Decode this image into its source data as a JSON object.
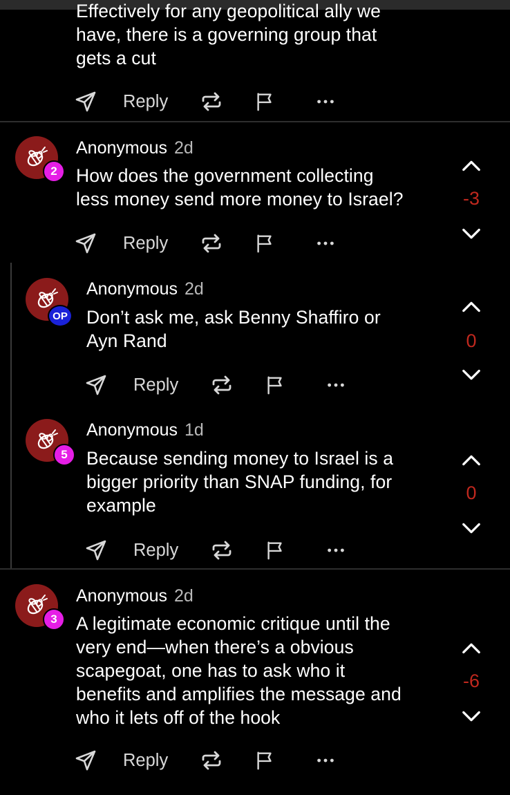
{
  "partial_comment": {
    "lines": [
      "Effectively for any geopolitical ally we",
      "have, there is a governing group that",
      "gets a cut"
    ],
    "reply_label": "Reply"
  },
  "comments": [
    {
      "author": "Anonymous",
      "time": "2d",
      "badge": "2",
      "lines": [
        "How does the government collecting",
        "less money send more money to Israel?"
      ],
      "score": "-3",
      "reply_label": "Reply"
    },
    {
      "author": "Anonymous",
      "time": "2d",
      "badge": "OP",
      "lines": [
        "Don’t ask me, ask Benny Shaffiro or",
        "Ayn Rand"
      ],
      "score": "0",
      "reply_label": "Reply"
    },
    {
      "author": "Anonymous",
      "time": "1d",
      "badge": "5",
      "lines": [
        "Because sending money to Israel is a",
        "bigger priority than SNAP funding, for",
        "example"
      ],
      "score": "0",
      "reply_label": "Reply"
    },
    {
      "author": "Anonymous",
      "time": "2d",
      "badge": "3",
      "lines": [
        "A legitimate economic critique until the",
        "very end—when there’s a obvious",
        "scapegoat, one has to ask who it",
        "benefits and amplifies the message and",
        "who it lets off of the hook"
      ],
      "score": "-6",
      "reply_label": "Reply"
    }
  ],
  "colors": {
    "background": "#000000",
    "avatar": "#8b1b1b",
    "badge_number": "#e61ee6",
    "badge_op": "#1a22d8",
    "score": "#c0281e"
  },
  "icons": [
    "share-icon",
    "repost-icon",
    "flag-icon",
    "more-icon",
    "upvote-icon",
    "downvote-icon",
    "avatar-bee-icon"
  ]
}
